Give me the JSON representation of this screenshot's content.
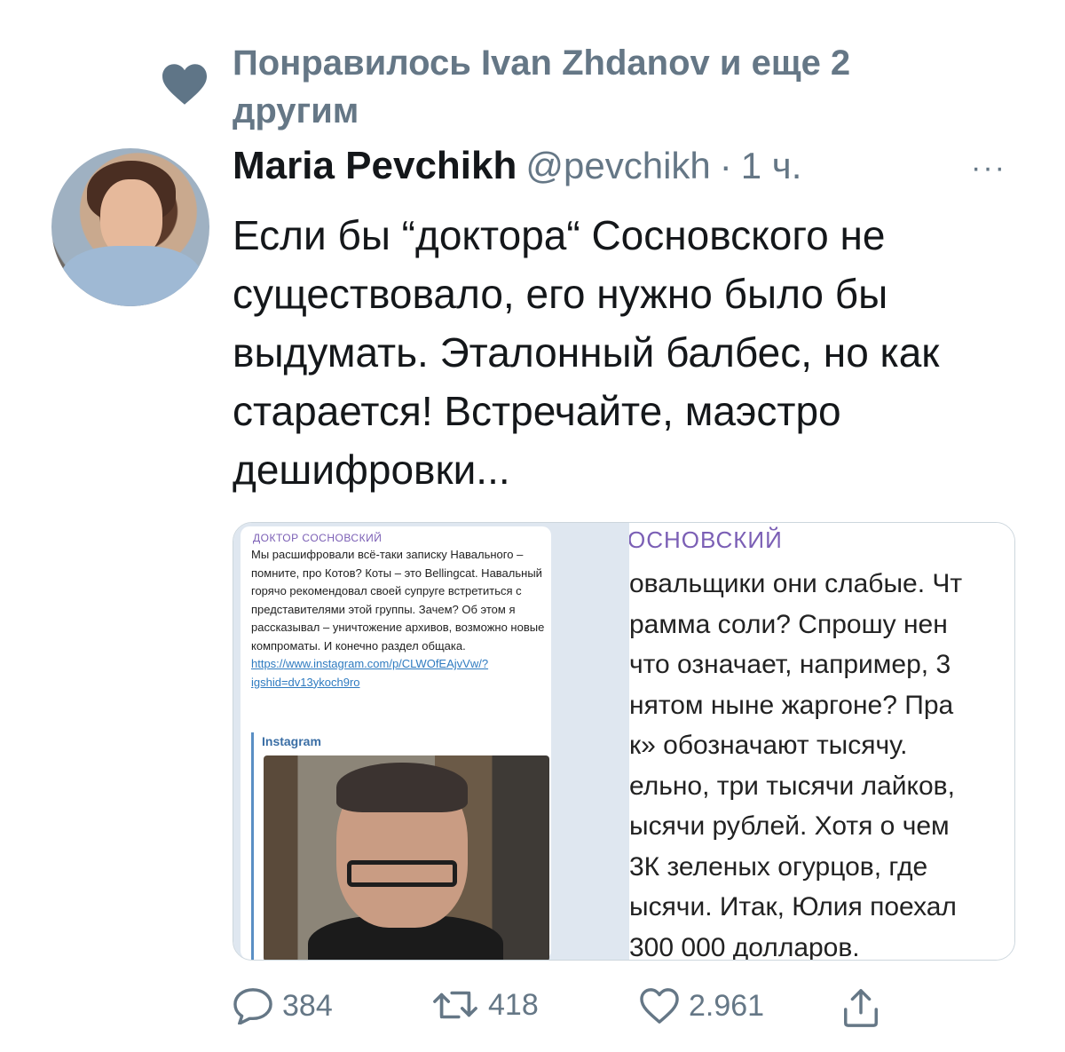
{
  "social_context": {
    "text": "Понравилось Ivan Zhdanov и еще 2 другим",
    "icon": "heart-icon"
  },
  "tweet": {
    "author_name": "Maria Pevchikh",
    "handle": "@pevchikh",
    "separator": "·",
    "time": "1 ч.",
    "more_label": "···",
    "text": "Если бы “доктора“ Сосновского не существовало, его нужно было бы выдумать. Эталонный балбес, но как старается! Встречайте, маэстро дешифровки..."
  },
  "media": {
    "left": {
      "channel": "ДОКТОР СОСНОВСКИЙ",
      "body": "Мы расшифровали всё-таки записку Навального – помните, про Котов? Коты – это Bellingcat. Навальный горячо рекомендовал своей супруге встретиться с представителями этой группы. Зачем? Об этом я рассказывал – уничтожение архивов, возможно новые компроматы. И конечно раздел общака.",
      "link": "https://www.instagram.com/p/CLWOfEAjvVw/?igshid=dv13ykoch9ro",
      "preview_title": "Instagram"
    },
    "right": {
      "channel": "ОСНОВСКИЙ",
      "lines": [
        "овальщики они слабые. Чт",
        "рамма соли? Спрошу нен",
        "что означает, например, 3",
        "нятом ныне жаргоне? Пра",
        "к» обозначают тысячу.",
        "ельно, три тысячи лайков,",
        "ысячи рублей. Хотя о чем",
        "3К зеленых огурцов, где",
        "ысячи. Итак, Юлия поехал",
        "300 000 долларов."
      ]
    }
  },
  "actions": {
    "reply_count": "384",
    "retweet_count": "418",
    "like_count": "2.961",
    "icons": [
      "reply-icon",
      "retweet-icon",
      "like-icon",
      "share-icon"
    ]
  },
  "colors": {
    "secondary_text": "#657786",
    "primary_text": "#14171a",
    "link": "#2f7bc0",
    "channel": "#7b5fb5"
  }
}
